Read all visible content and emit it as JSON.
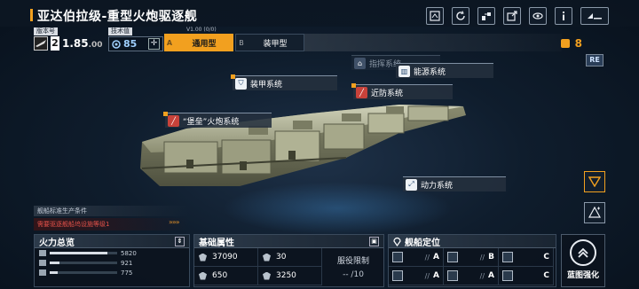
{
  "title": "亚达伯拉级-重型火炮驱逐舰",
  "top_icons": [
    "frame-icon",
    "refresh-icon",
    "transfer-icon",
    "share-icon",
    "view-icon",
    "info-icon",
    "back-icon"
  ],
  "version": {
    "label": "版本号",
    "level": "2",
    "value": "1.85",
    "suffix": ".00"
  },
  "tech": {
    "label": "技术值",
    "value": "85"
  },
  "tabs": {
    "sub_label": "V1.00 (0/0)",
    "a": {
      "letter": "A",
      "label": "通用型"
    },
    "b": {
      "letter": "B",
      "label": "装甲型"
    }
  },
  "resource_count": "8",
  "re_badge": "RE",
  "systems": {
    "command": "指挥系统",
    "energy": "能源系统",
    "armor": "装甲系统",
    "cic": "近防系统",
    "artillery": "“堡垒”火炮系统",
    "power": "动力系统"
  },
  "production": {
    "title": "舰船标准生产条件",
    "warning": "需要驱逐舰船坞设施等级1",
    "arrows": "»»»"
  },
  "firepower": {
    "title": "火力总览",
    "rows": [
      {
        "value": "5820",
        "fill": 0.85
      },
      {
        "value": "921",
        "fill": 0.14
      },
      {
        "value": "775",
        "fill": 0.12
      }
    ]
  },
  "basic": {
    "title": "基础属性",
    "cells": [
      "37090",
      "30",
      "650",
      "3250"
    ],
    "service_label": "服役限制",
    "service_value": "-- /10"
  },
  "positioning": {
    "title": "舰船定位",
    "cells": [
      {
        "slash": "//",
        "grade": "A"
      },
      {
        "slash": "//",
        "grade": "B"
      },
      {
        "slash": "",
        "grade": "C"
      },
      {
        "slash": "//",
        "grade": "A"
      },
      {
        "slash": "//",
        "grade": "A"
      },
      {
        "slash": "",
        "grade": "C"
      }
    ]
  },
  "blueprint": {
    "label": "蓝图强化"
  },
  "colors": {
    "accent": "#f2a01f",
    "warning": "#e4524a",
    "background": "#0f1d2d"
  }
}
